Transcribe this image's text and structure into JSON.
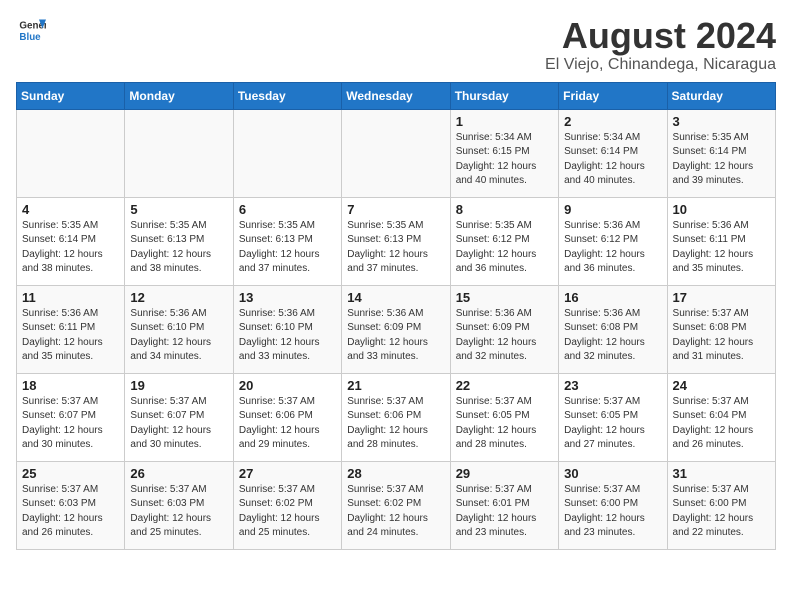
{
  "logo": {
    "line1": "General",
    "line2": "Blue"
  },
  "title": "August 2024",
  "subtitle": "El Viejo, Chinandega, Nicaragua",
  "weekdays": [
    "Sunday",
    "Monday",
    "Tuesday",
    "Wednesday",
    "Thursday",
    "Friday",
    "Saturday"
  ],
  "weeks": [
    [
      {
        "day": "",
        "info": ""
      },
      {
        "day": "",
        "info": ""
      },
      {
        "day": "",
        "info": ""
      },
      {
        "day": "",
        "info": ""
      },
      {
        "day": "1",
        "info": "Sunrise: 5:34 AM\nSunset: 6:15 PM\nDaylight: 12 hours\nand 40 minutes."
      },
      {
        "day": "2",
        "info": "Sunrise: 5:34 AM\nSunset: 6:14 PM\nDaylight: 12 hours\nand 40 minutes."
      },
      {
        "day": "3",
        "info": "Sunrise: 5:35 AM\nSunset: 6:14 PM\nDaylight: 12 hours\nand 39 minutes."
      }
    ],
    [
      {
        "day": "4",
        "info": "Sunrise: 5:35 AM\nSunset: 6:14 PM\nDaylight: 12 hours\nand 38 minutes."
      },
      {
        "day": "5",
        "info": "Sunrise: 5:35 AM\nSunset: 6:13 PM\nDaylight: 12 hours\nand 38 minutes."
      },
      {
        "day": "6",
        "info": "Sunrise: 5:35 AM\nSunset: 6:13 PM\nDaylight: 12 hours\nand 37 minutes."
      },
      {
        "day": "7",
        "info": "Sunrise: 5:35 AM\nSunset: 6:13 PM\nDaylight: 12 hours\nand 37 minutes."
      },
      {
        "day": "8",
        "info": "Sunrise: 5:35 AM\nSunset: 6:12 PM\nDaylight: 12 hours\nand 36 minutes."
      },
      {
        "day": "9",
        "info": "Sunrise: 5:36 AM\nSunset: 6:12 PM\nDaylight: 12 hours\nand 36 minutes."
      },
      {
        "day": "10",
        "info": "Sunrise: 5:36 AM\nSunset: 6:11 PM\nDaylight: 12 hours\nand 35 minutes."
      }
    ],
    [
      {
        "day": "11",
        "info": "Sunrise: 5:36 AM\nSunset: 6:11 PM\nDaylight: 12 hours\nand 35 minutes."
      },
      {
        "day": "12",
        "info": "Sunrise: 5:36 AM\nSunset: 6:10 PM\nDaylight: 12 hours\nand 34 minutes."
      },
      {
        "day": "13",
        "info": "Sunrise: 5:36 AM\nSunset: 6:10 PM\nDaylight: 12 hours\nand 33 minutes."
      },
      {
        "day": "14",
        "info": "Sunrise: 5:36 AM\nSunset: 6:09 PM\nDaylight: 12 hours\nand 33 minutes."
      },
      {
        "day": "15",
        "info": "Sunrise: 5:36 AM\nSunset: 6:09 PM\nDaylight: 12 hours\nand 32 minutes."
      },
      {
        "day": "16",
        "info": "Sunrise: 5:36 AM\nSunset: 6:08 PM\nDaylight: 12 hours\nand 32 minutes."
      },
      {
        "day": "17",
        "info": "Sunrise: 5:37 AM\nSunset: 6:08 PM\nDaylight: 12 hours\nand 31 minutes."
      }
    ],
    [
      {
        "day": "18",
        "info": "Sunrise: 5:37 AM\nSunset: 6:07 PM\nDaylight: 12 hours\nand 30 minutes."
      },
      {
        "day": "19",
        "info": "Sunrise: 5:37 AM\nSunset: 6:07 PM\nDaylight: 12 hours\nand 30 minutes."
      },
      {
        "day": "20",
        "info": "Sunrise: 5:37 AM\nSunset: 6:06 PM\nDaylight: 12 hours\nand 29 minutes."
      },
      {
        "day": "21",
        "info": "Sunrise: 5:37 AM\nSunset: 6:06 PM\nDaylight: 12 hours\nand 28 minutes."
      },
      {
        "day": "22",
        "info": "Sunrise: 5:37 AM\nSunset: 6:05 PM\nDaylight: 12 hours\nand 28 minutes."
      },
      {
        "day": "23",
        "info": "Sunrise: 5:37 AM\nSunset: 6:05 PM\nDaylight: 12 hours\nand 27 minutes."
      },
      {
        "day": "24",
        "info": "Sunrise: 5:37 AM\nSunset: 6:04 PM\nDaylight: 12 hours\nand 26 minutes."
      }
    ],
    [
      {
        "day": "25",
        "info": "Sunrise: 5:37 AM\nSunset: 6:03 PM\nDaylight: 12 hours\nand 26 minutes."
      },
      {
        "day": "26",
        "info": "Sunrise: 5:37 AM\nSunset: 6:03 PM\nDaylight: 12 hours\nand 25 minutes."
      },
      {
        "day": "27",
        "info": "Sunrise: 5:37 AM\nSunset: 6:02 PM\nDaylight: 12 hours\nand 25 minutes."
      },
      {
        "day": "28",
        "info": "Sunrise: 5:37 AM\nSunset: 6:02 PM\nDaylight: 12 hours\nand 24 minutes."
      },
      {
        "day": "29",
        "info": "Sunrise: 5:37 AM\nSunset: 6:01 PM\nDaylight: 12 hours\nand 23 minutes."
      },
      {
        "day": "30",
        "info": "Sunrise: 5:37 AM\nSunset: 6:00 PM\nDaylight: 12 hours\nand 23 minutes."
      },
      {
        "day": "31",
        "info": "Sunrise: 5:37 AM\nSunset: 6:00 PM\nDaylight: 12 hours\nand 22 minutes."
      }
    ]
  ]
}
